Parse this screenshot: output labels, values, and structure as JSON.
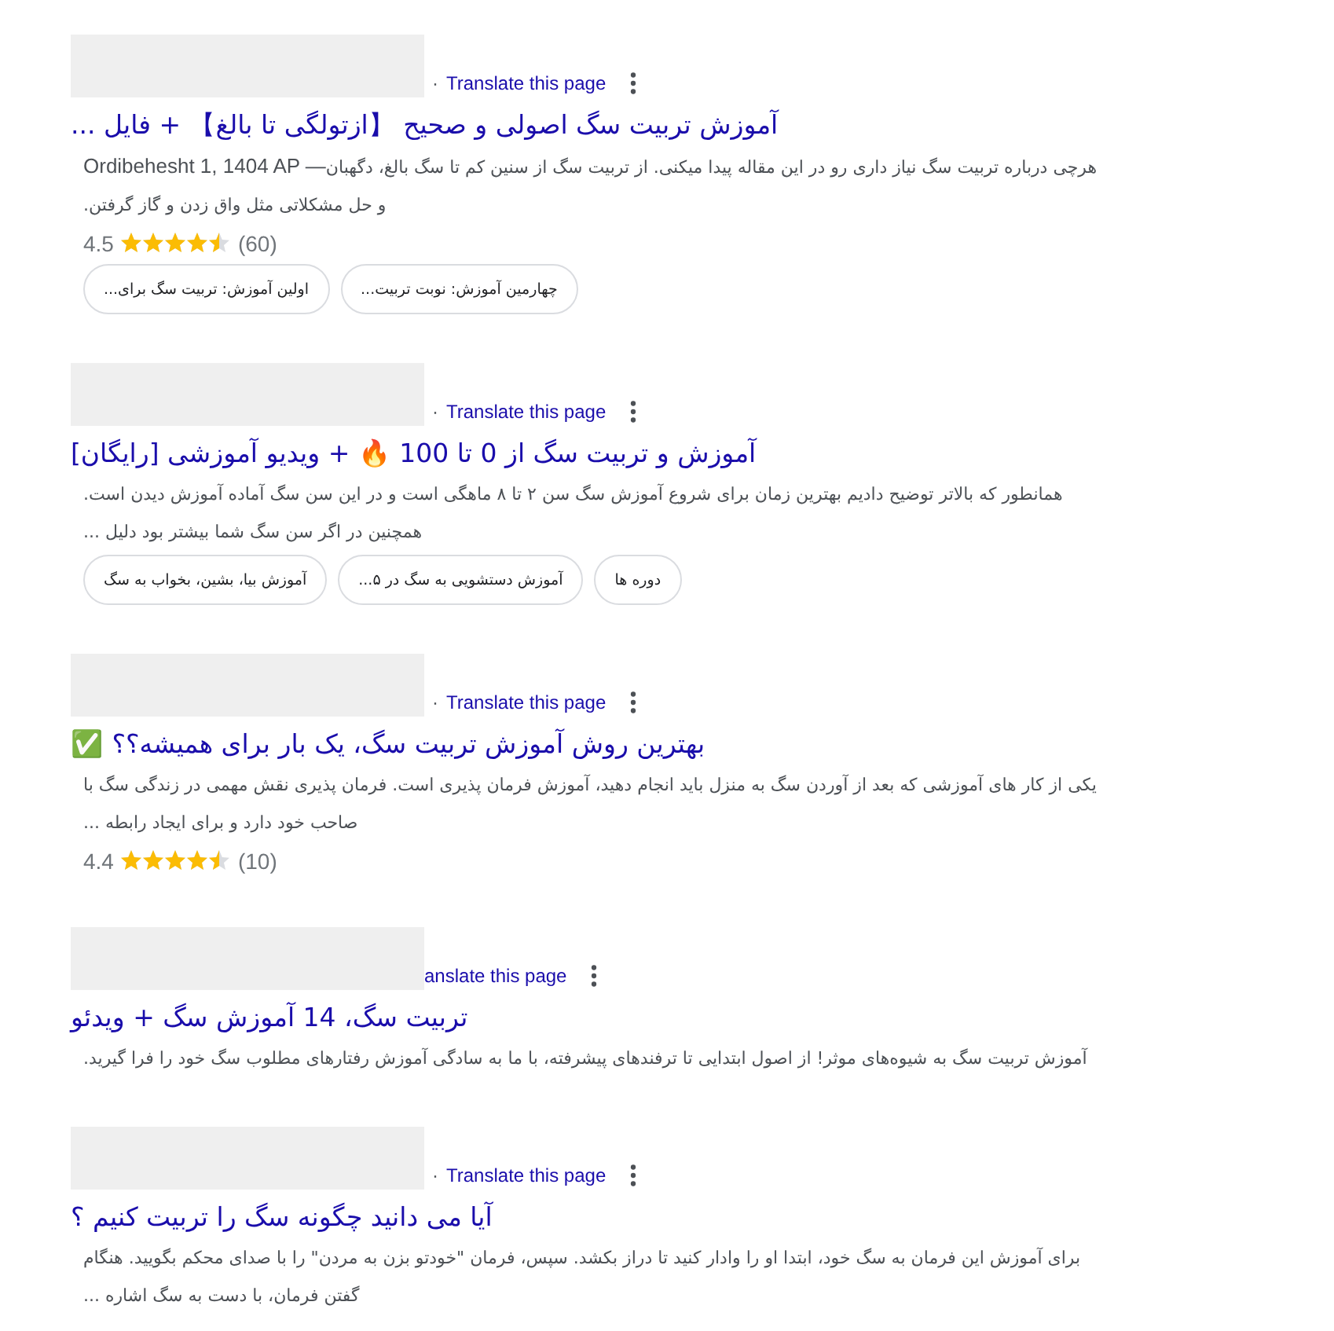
{
  "results": [
    {
      "header": {
        "separator": "·",
        "translate_link": "Translate this page"
      },
      "title": "آموزش تربیت سگ اصولی و صحیح 【ازتولگی تا بالغ】 + فایل ...",
      "date": "Ordibehesht 1, 1404 AP —",
      "snippet": "هرچی درباره تربیت سگ نیاز داری رو در این مقاله پیدا میکنی. از تربیت سگ از سنین کم تا سگ بالغ، دگهبان و حل مشکلاتی مثل واق زدن و گاز گرفتن.",
      "rating": {
        "value": "4.5",
        "stars": 4.5,
        "count": "(60)"
      },
      "chips": [
        "چهارمین آموزش: نوبت تربیت...",
        "اولین آموزش: تربیت سگ برای..."
      ]
    },
    {
      "header": {
        "separator": "·",
        "translate_link": "Translate this page"
      },
      "title": "آموزش و تربیت سگ از 0 تا 100 🔥 + ویدیو آموزشی [رایگان]",
      "snippet": "همانطور که بالاتر توضیح دادیم بهترین زمان برای شروع آموزش سگ سن ۲ تا ۸ ماهگی است و در این سن سگ آماده آموزش دیدن است. همچنین در اگر سن سگ شما بیشتر بود دلیل ...",
      "chips": [
        "دوره ها",
        "آموزش دستشویی به سگ در ۵...",
        "آموزش بیا، بشین، بخواب به سگ"
      ]
    },
    {
      "header": {
        "separator": "·",
        "translate_link": "Translate this page"
      },
      "title": "بهترین روش آموزش تربیت سگ، یک بار برای همیشه؟؟ ✅",
      "snippet": "یکی از کار های آموزشی که بعد از آوردن سگ به منزل باید انجام دهید، آموزش فرمان پذیری است. فرمان پذیری نقش مهمی در زندگی سگ با صاحب خود دارد و برای ایجاد رابطه ...",
      "rating": {
        "value": "4.4",
        "stars": 4.5,
        "count": "(10)"
      }
    },
    {
      "header": {
        "translate_link": "anslate this page"
      },
      "title": "تربیت سگ، 14 آموزش سگ + ویدئو",
      "snippet": "آموزش تربیت سگ به شیوه‌های موثر! از اصول ابتدایی تا ترفندهای پیشرفته، با ما به سادگی آموزش رفتارهای مطلوب سگ خود را فرا گیرید."
    },
    {
      "header": {
        "separator": "·",
        "translate_link": "Translate this page"
      },
      "title": "آیا می دانید چگونه سگ را تربیت کنیم ؟",
      "snippet": "برای آموزش این فرمان به سگ خود، ابتدا او را وادار کنید تا دراز بکشد. سپس، فرمان \"خودتو بزن به مردن\" را با صدای محکم بگویید. هنگام گفتن فرمان، با دست به سگ اشاره ..."
    }
  ]
}
